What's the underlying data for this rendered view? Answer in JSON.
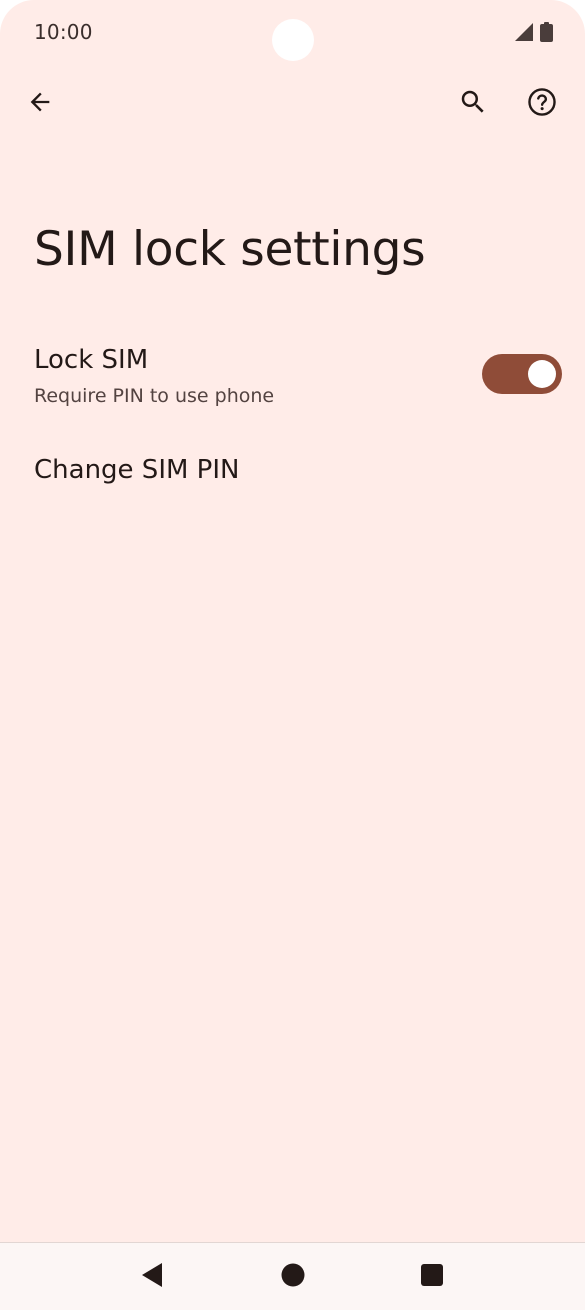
{
  "status_bar": {
    "time": "10:00",
    "icons": [
      "signal-icon",
      "battery-icon"
    ]
  },
  "app_bar": {
    "back_icon": "arrow-back-icon",
    "search_icon": "search-icon",
    "help_icon": "help-icon"
  },
  "page": {
    "title": "SIM lock settings"
  },
  "preferences": {
    "lock_sim": {
      "title": "Lock SIM",
      "summary": "Require PIN to use phone",
      "enabled": true
    },
    "change_pin": {
      "title": "Change SIM PIN"
    }
  },
  "nav_bar": {
    "icons": [
      "nav-back-icon",
      "nav-home-icon",
      "nav-recents-icon"
    ]
  },
  "colors": {
    "background": "#ffece8",
    "accent": "#8f4c38",
    "text_primary": "#231917",
    "text_secondary": "#534341",
    "nav_background": "#fcf6f5"
  }
}
